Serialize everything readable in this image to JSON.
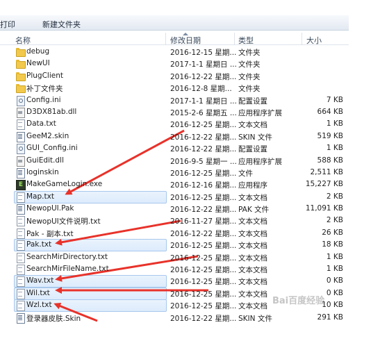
{
  "toolbar": {
    "print_label": "打印",
    "new_folder_label": "新建文件夹"
  },
  "columns": {
    "name": "名称",
    "date": "修改日期",
    "type": "类型",
    "size": "大小"
  },
  "files": [
    {
      "name": "debug",
      "date": "2016-12-15 星期...",
      "type": "文件夹",
      "size": "",
      "icon": "folder-icon",
      "selected": false
    },
    {
      "name": "NewUI",
      "date": "2017-1-1 星期日 ...",
      "type": "文件夹",
      "size": "",
      "icon": "folder-icon",
      "selected": false
    },
    {
      "name": "PlugClient",
      "date": "2016-12-22 星期...",
      "type": "文件夹",
      "size": "",
      "icon": "folder-icon",
      "selected": false
    },
    {
      "name": "补丁文件夹",
      "date": "2016-12-8 星期...",
      "type": "文件夹",
      "size": "",
      "icon": "folder-icon",
      "selected": false
    },
    {
      "name": "Config.ini",
      "date": "2017-1-1 星期日 ...",
      "type": "配置设置",
      "size": "7 KB",
      "icon": "config-file-icon",
      "selected": false
    },
    {
      "name": "D3DX81ab.dll",
      "date": "2015-2-6 星期五 ...",
      "type": "应用程序扩展",
      "size": "664 KB",
      "icon": "dll-file-icon",
      "selected": false
    },
    {
      "name": "Data.txt",
      "date": "2016-12-25 星期...",
      "type": "文本文档",
      "size": "1 KB",
      "icon": "text-file-icon",
      "selected": false
    },
    {
      "name": "GeeM2.skin",
      "date": "2016-12-22 星期...",
      "type": "SKIN 文件",
      "size": "519 KB",
      "icon": "skin-file-icon",
      "selected": false
    },
    {
      "name": "GUI_Config.ini",
      "date": "2016-12-22 星期...",
      "type": "配置设置",
      "size": "1 KB",
      "icon": "config-file-icon",
      "selected": false
    },
    {
      "name": "GuiEdit.dll",
      "date": "2016-9-5 星期一 ...",
      "type": "应用程序扩展",
      "size": "588 KB",
      "icon": "dll-file-icon",
      "selected": false
    },
    {
      "name": "loginskin",
      "date": "2016-12-25 星期...",
      "type": "文件",
      "size": "2,511 KB",
      "icon": "skin-file-icon",
      "selected": false
    },
    {
      "name": "MakeGameLogin.exe",
      "date": "2016-12-16 星期...",
      "type": "应用程序",
      "size": "15,227 KB",
      "icon": "exe-file-icon",
      "selected": false
    },
    {
      "name": "Map.txt",
      "date": "2016-12-25 星期...",
      "type": "文本文档",
      "size": "2 KB",
      "icon": "text-file-icon",
      "selected": true
    },
    {
      "name": "NewopUI.Pak",
      "date": "2016-12-22 星期...",
      "type": "PAK 文件",
      "size": "11,091 KB",
      "icon": "skin-file-icon",
      "selected": false
    },
    {
      "name": "NewopUI文件说明.txt",
      "date": "2016-11-27 星期...",
      "type": "文本文档",
      "size": "2 KB",
      "icon": "text-file-icon",
      "selected": false
    },
    {
      "name": "Pak - 副本.txt",
      "date": "2016-12-22 星期...",
      "type": "文本文档",
      "size": "26 KB",
      "icon": "text-file-icon",
      "selected": false
    },
    {
      "name": "Pak.txt",
      "date": "2016-12-25 星期...",
      "type": "文本文档",
      "size": "18 KB",
      "icon": "text-file-icon",
      "selected": true
    },
    {
      "name": "SearchMirDirectory.txt",
      "date": "2016-12-25 星期...",
      "type": "文本文档",
      "size": "1 KB",
      "icon": "text-file-icon",
      "selected": false
    },
    {
      "name": "SearchMirFileName.txt",
      "date": "2016-12-25 星期...",
      "type": "文本文档",
      "size": "1 KB",
      "icon": "text-file-icon",
      "selected": false
    },
    {
      "name": "Wav.txt",
      "date": "2016-12-25 星期...",
      "type": "文本文档",
      "size": "0 KB",
      "icon": "text-file-icon",
      "selected": true
    },
    {
      "name": "Wil.txt",
      "date": "2016-12-25 星期...",
      "type": "文本文档",
      "size": "0 KB",
      "icon": "text-file-icon",
      "selected": true
    },
    {
      "name": "Wzl.txt",
      "date": "2016-12-25 星期...",
      "type": "文本文档",
      "size": "10 KB",
      "icon": "text-file-icon",
      "selected": true
    },
    {
      "name": "登录器皮肤.Skin",
      "date": "2016-12-22 星期...",
      "type": "SKIN 文件",
      "size": "291 KB",
      "icon": "skin-file-icon",
      "selected": false
    }
  ],
  "colors": {
    "selection_fill": "#dcebfc",
    "selection_border": "#a8c8ec",
    "arrow": "#e8322a"
  },
  "watermark": "Bai百度经验"
}
